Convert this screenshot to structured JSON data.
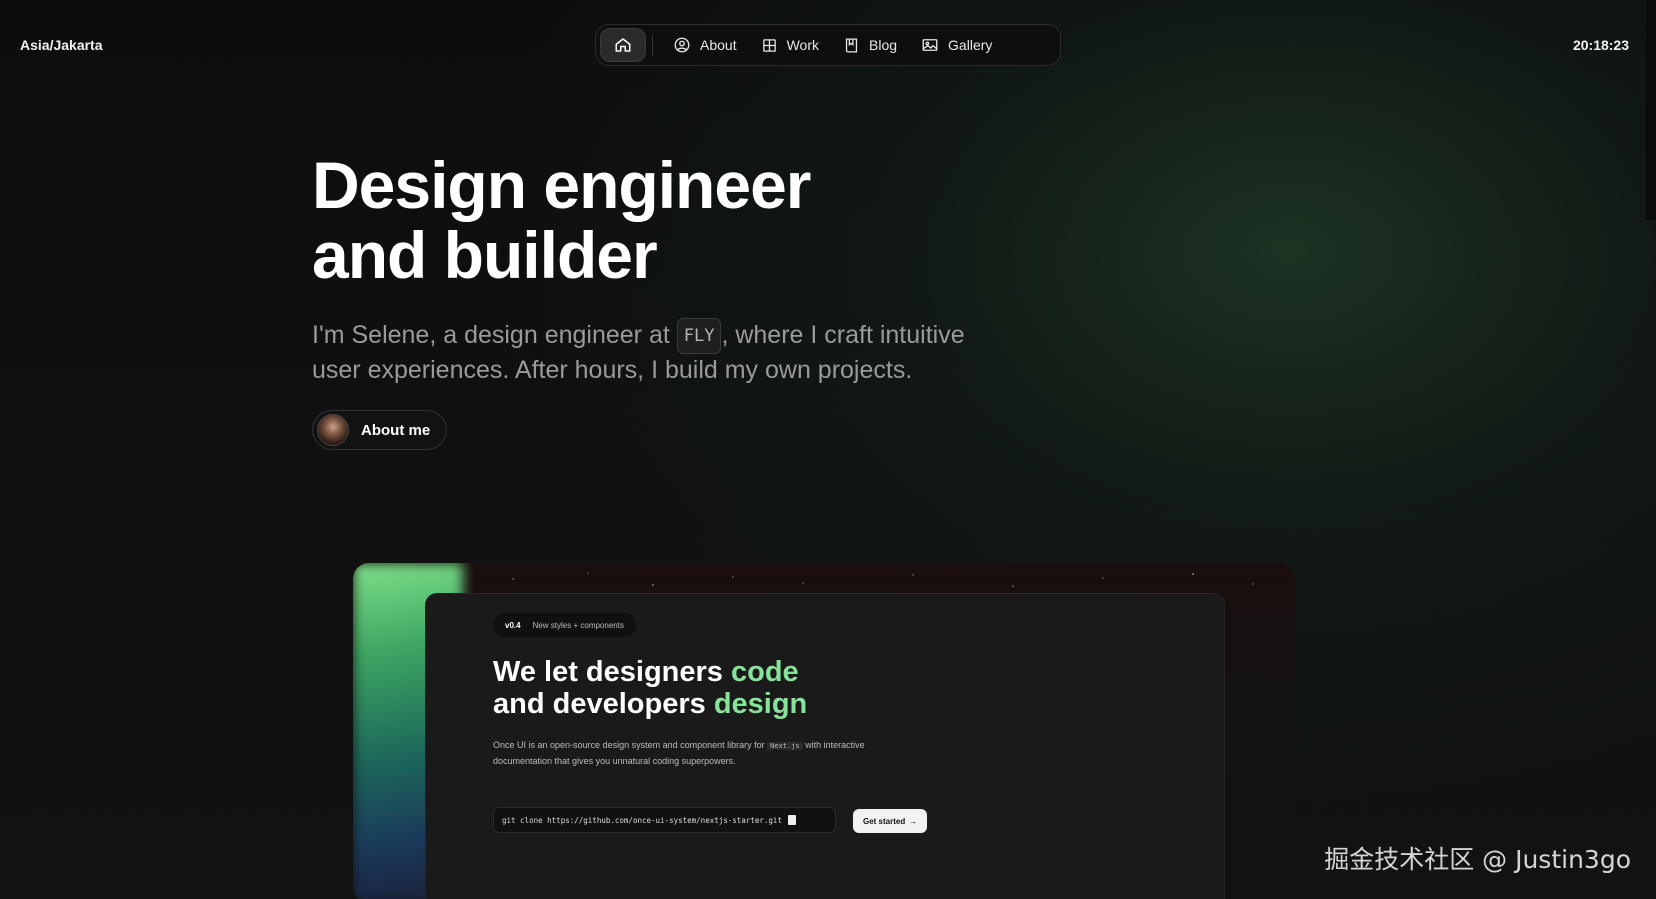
{
  "header": {
    "timezone": "Asia/Jakarta",
    "time": "20:18:23"
  },
  "nav": {
    "home_icon": "home-icon",
    "items": [
      {
        "label": "About",
        "icon": "person-circle-icon"
      },
      {
        "label": "Work",
        "icon": "grid-icon"
      },
      {
        "label": "Blog",
        "icon": "book-icon"
      },
      {
        "label": "Gallery",
        "icon": "image-icon"
      }
    ]
  },
  "hero": {
    "title_line1": "Design engineer",
    "title_line2": "and builder",
    "subtitle_before": "I'm Selene, a design engineer at ",
    "subtitle_code": "FLY",
    "subtitle_after": ", where I craft intuitive user experiences. After hours, I build my own projects.",
    "about_button": "About me"
  },
  "preview": {
    "tag_version": "v0.4",
    "tag_text": "New styles + components",
    "title_a": "We let designers ",
    "title_b": "code",
    "title_c": "and developers ",
    "title_d": "design",
    "desc_before": "Once UI is an open-source design system and component library for ",
    "desc_code": "Next.js",
    "desc_after": " with interactive documentation that gives you unnatural coding superpowers.",
    "clone_command": "git clone https://github.com/once-ui-system/nextjs-starter.git",
    "cta": "Get started",
    "cta_arrow": "→"
  },
  "watermark": "掘金技术社区 @ Justin3go",
  "colors": {
    "accent": "#86e39a",
    "background": "#0d0d0d"
  }
}
